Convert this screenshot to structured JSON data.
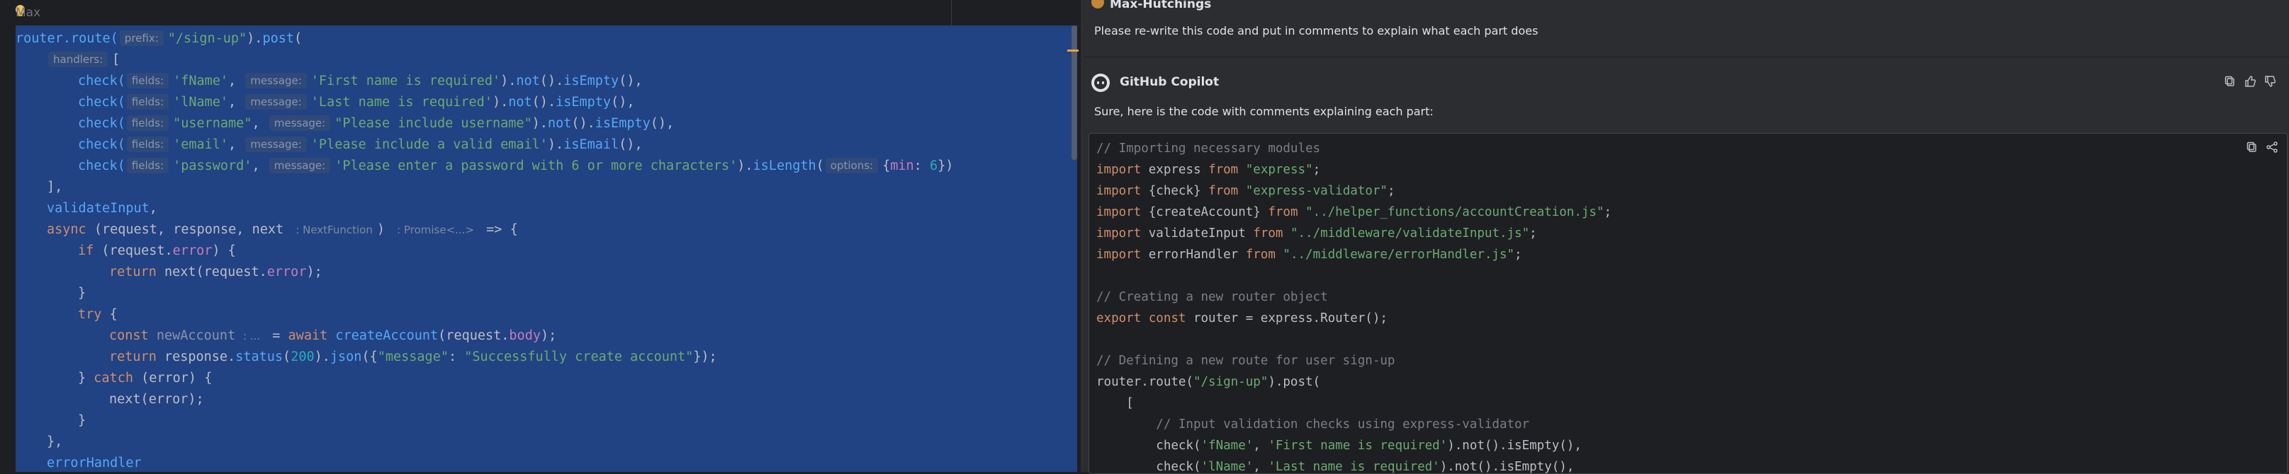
{
  "editor": {
    "inline_author": "Max",
    "code_lines": [
      [
        [
          "router.route(",
          "fn-router"
        ],
        [
          "prefix:",
          "hint"
        ],
        [
          "\"/sign-up\"",
          "str"
        ],
        [
          ").",
          "var"
        ],
        [
          "post",
          "fn"
        ],
        [
          "(",
          "var"
        ]
      ],
      [
        [
          "handlers:",
          "hint"
        ],
        [
          "[",
          "var"
        ]
      ],
      [
        [
          "check(",
          "fn"
        ],
        [
          "fields:",
          "hint"
        ],
        [
          "'fName'",
          "str"
        ],
        [
          ", ",
          "var"
        ],
        [
          "message:",
          "hint"
        ],
        [
          "'First name is required'",
          "str"
        ],
        [
          ").",
          "var"
        ],
        [
          "not",
          "fn"
        ],
        [
          "().",
          "var"
        ],
        [
          "isEmpty",
          "fn"
        ],
        [
          "(),",
          "var"
        ]
      ],
      [
        [
          "check(",
          "fn"
        ],
        [
          "fields:",
          "hint"
        ],
        [
          "'lName'",
          "str"
        ],
        [
          ", ",
          "var"
        ],
        [
          "message:",
          "hint"
        ],
        [
          "'Last name is required'",
          "str"
        ],
        [
          ").",
          "var"
        ],
        [
          "not",
          "fn"
        ],
        [
          "().",
          "var"
        ],
        [
          "isEmpty",
          "fn"
        ],
        [
          "(),",
          "var"
        ]
      ],
      [
        [
          "check(",
          "fn"
        ],
        [
          "fields:",
          "hint"
        ],
        [
          "\"username\"",
          "str"
        ],
        [
          ", ",
          "var"
        ],
        [
          "message:",
          "hint"
        ],
        [
          "\"Please include username\"",
          "str"
        ],
        [
          ").",
          "var"
        ],
        [
          "not",
          "fn"
        ],
        [
          "().",
          "var"
        ],
        [
          "isEmpty",
          "fn"
        ],
        [
          "(),",
          "var"
        ]
      ],
      [
        [
          "check(",
          "fn"
        ],
        [
          "fields:",
          "hint"
        ],
        [
          "'email'",
          "str"
        ],
        [
          ", ",
          "var"
        ],
        [
          "message:",
          "hint"
        ],
        [
          "'Please include a valid email'",
          "str"
        ],
        [
          ").",
          "var"
        ],
        [
          "isEmail",
          "fn"
        ],
        [
          "(),",
          "var"
        ]
      ],
      [
        [
          "check(",
          "fn"
        ],
        [
          "fields:",
          "hint"
        ],
        [
          "'password'",
          "str"
        ],
        [
          ", ",
          "var"
        ],
        [
          "message:",
          "hint"
        ],
        [
          "'Please enter a password with 6 or more characters'",
          "str"
        ],
        [
          ").",
          "var"
        ],
        [
          "isLength",
          "fn"
        ],
        [
          "(",
          "var"
        ],
        [
          "options:",
          "hint"
        ],
        [
          "{",
          "var"
        ],
        [
          "min",
          "prop"
        ],
        [
          ": ",
          "var"
        ],
        [
          "6",
          "num"
        ],
        [
          "})",
          "var"
        ]
      ],
      [
        [
          "],",
          "var"
        ]
      ],
      [
        [
          "validateInput",
          "fn"
        ],
        [
          ",",
          "var"
        ]
      ],
      [
        [
          "async ",
          "kw"
        ],
        [
          "(request, response, next ",
          "var"
        ],
        [
          ": NextFunction",
          "hintplain"
        ],
        [
          ") ",
          "var"
        ],
        [
          ": Promise<...>",
          "hintplain"
        ],
        [
          " => {",
          "var"
        ]
      ],
      [
        [
          "if ",
          "kw"
        ],
        [
          "(request.",
          "var"
        ],
        [
          "error",
          "prop"
        ],
        [
          ") {",
          "var"
        ]
      ],
      [
        [
          "return ",
          "kw"
        ],
        [
          "next(request.",
          "var"
        ],
        [
          "error",
          "prop"
        ],
        [
          ");",
          "var"
        ]
      ],
      [
        [
          "}",
          "var"
        ]
      ],
      [
        [
          "try ",
          "kw"
        ],
        [
          "{",
          "var"
        ]
      ],
      [
        [
          "const ",
          "kw"
        ],
        [
          "newAccount",
          "dim"
        ],
        [
          " : ...",
          "hintplain"
        ],
        [
          " = ",
          "var"
        ],
        [
          "await ",
          "kw"
        ],
        [
          "createAccount",
          "fn"
        ],
        [
          "(request.",
          "var"
        ],
        [
          "body",
          "prop"
        ],
        [
          ");",
          "var"
        ]
      ],
      [
        [
          "return ",
          "kw"
        ],
        [
          "response.",
          "var"
        ],
        [
          "status",
          "fn"
        ],
        [
          "(",
          "var"
        ],
        [
          "200",
          "num"
        ],
        [
          ").",
          "var"
        ],
        [
          "json",
          "fn"
        ],
        [
          "({",
          "var"
        ],
        [
          "\"message\"",
          "str"
        ],
        [
          ": ",
          "var"
        ],
        [
          "\"Successfully create account\"",
          "str"
        ],
        [
          "});",
          "var"
        ]
      ],
      [
        [
          "} ",
          "var"
        ],
        [
          "catch ",
          "kw"
        ],
        [
          "(error) {",
          "var"
        ]
      ],
      [
        [
          "next(error);",
          "var"
        ]
      ],
      [
        [
          "}",
          "var"
        ]
      ],
      [
        [
          "},",
          "var"
        ]
      ],
      [
        [
          "errorHandler",
          "fn"
        ]
      ]
    ]
  },
  "chat": {
    "user_name": "Max-Hutchings",
    "user_message": "Please re-write this code and put in comments to explain what each part does",
    "assistant_name": "GitHub Copilot",
    "assistant_intro": "Sure, here is the code with comments explaining each part:",
    "code_lines": [
      [
        [
          "// Importing necessary modules",
          "cmt"
        ]
      ],
      [
        [
          "import ",
          "kw"
        ],
        [
          "express ",
          "var"
        ],
        [
          "from ",
          "kw"
        ],
        [
          "\"express\"",
          "str"
        ],
        [
          ";",
          "var"
        ]
      ],
      [
        [
          "import ",
          "kw"
        ],
        [
          "{check} ",
          "var"
        ],
        [
          "from ",
          "kw"
        ],
        [
          "\"express-validator\"",
          "str"
        ],
        [
          ";",
          "var"
        ]
      ],
      [
        [
          "import ",
          "kw"
        ],
        [
          "{createAccount} ",
          "var"
        ],
        [
          "from ",
          "kw"
        ],
        [
          "\"../helper_functions/accountCreation.js\"",
          "str"
        ],
        [
          ";",
          "var"
        ]
      ],
      [
        [
          "import ",
          "kw"
        ],
        [
          "validateInput ",
          "var"
        ],
        [
          "from ",
          "kw"
        ],
        [
          "\"../middleware/validateInput.js\"",
          "str"
        ],
        [
          ";",
          "var"
        ]
      ],
      [
        [
          "import ",
          "kw"
        ],
        [
          "errorHandler ",
          "var"
        ],
        [
          "from ",
          "kw"
        ],
        [
          "\"../middleware/errorHandler.js\"",
          "str"
        ],
        [
          ";",
          "var"
        ]
      ],
      [
        [
          "",
          "var"
        ]
      ],
      [
        [
          "// Creating a new router object",
          "cmt"
        ]
      ],
      [
        [
          "export const ",
          "kw"
        ],
        [
          "router = express.Router();",
          "var"
        ]
      ],
      [
        [
          "",
          "var"
        ]
      ],
      [
        [
          "// Defining a new route for user sign-up",
          "cmt"
        ]
      ],
      [
        [
          "router.route(",
          "var"
        ],
        [
          "\"/sign-up\"",
          "str"
        ],
        [
          ").post(",
          "var"
        ]
      ],
      [
        [
          "    [",
          "var"
        ]
      ],
      [
        [
          "        // Input validation checks using express-validator",
          "cmt"
        ]
      ],
      [
        [
          "        check(",
          "var"
        ],
        [
          "'fName'",
          "str"
        ],
        [
          ", ",
          "var"
        ],
        [
          "'First name is required'",
          "str"
        ],
        [
          ").not().isEmpty(),",
          "var"
        ]
      ],
      [
        [
          "        check(",
          "var"
        ],
        [
          "'lName'",
          "str"
        ],
        [
          ", ",
          "var"
        ],
        [
          "'Last name is required'",
          "str"
        ],
        [
          ").not().isEmpty(),",
          "var"
        ]
      ]
    ]
  },
  "colors": {
    "selection": "#214283",
    "editor_bg": "#1e1f22",
    "chat_bg": "#2b2d30",
    "string": "#6aab73",
    "keyword": "#cf8e6d",
    "function": "#56a8f5",
    "comment": "#7a7e85"
  }
}
